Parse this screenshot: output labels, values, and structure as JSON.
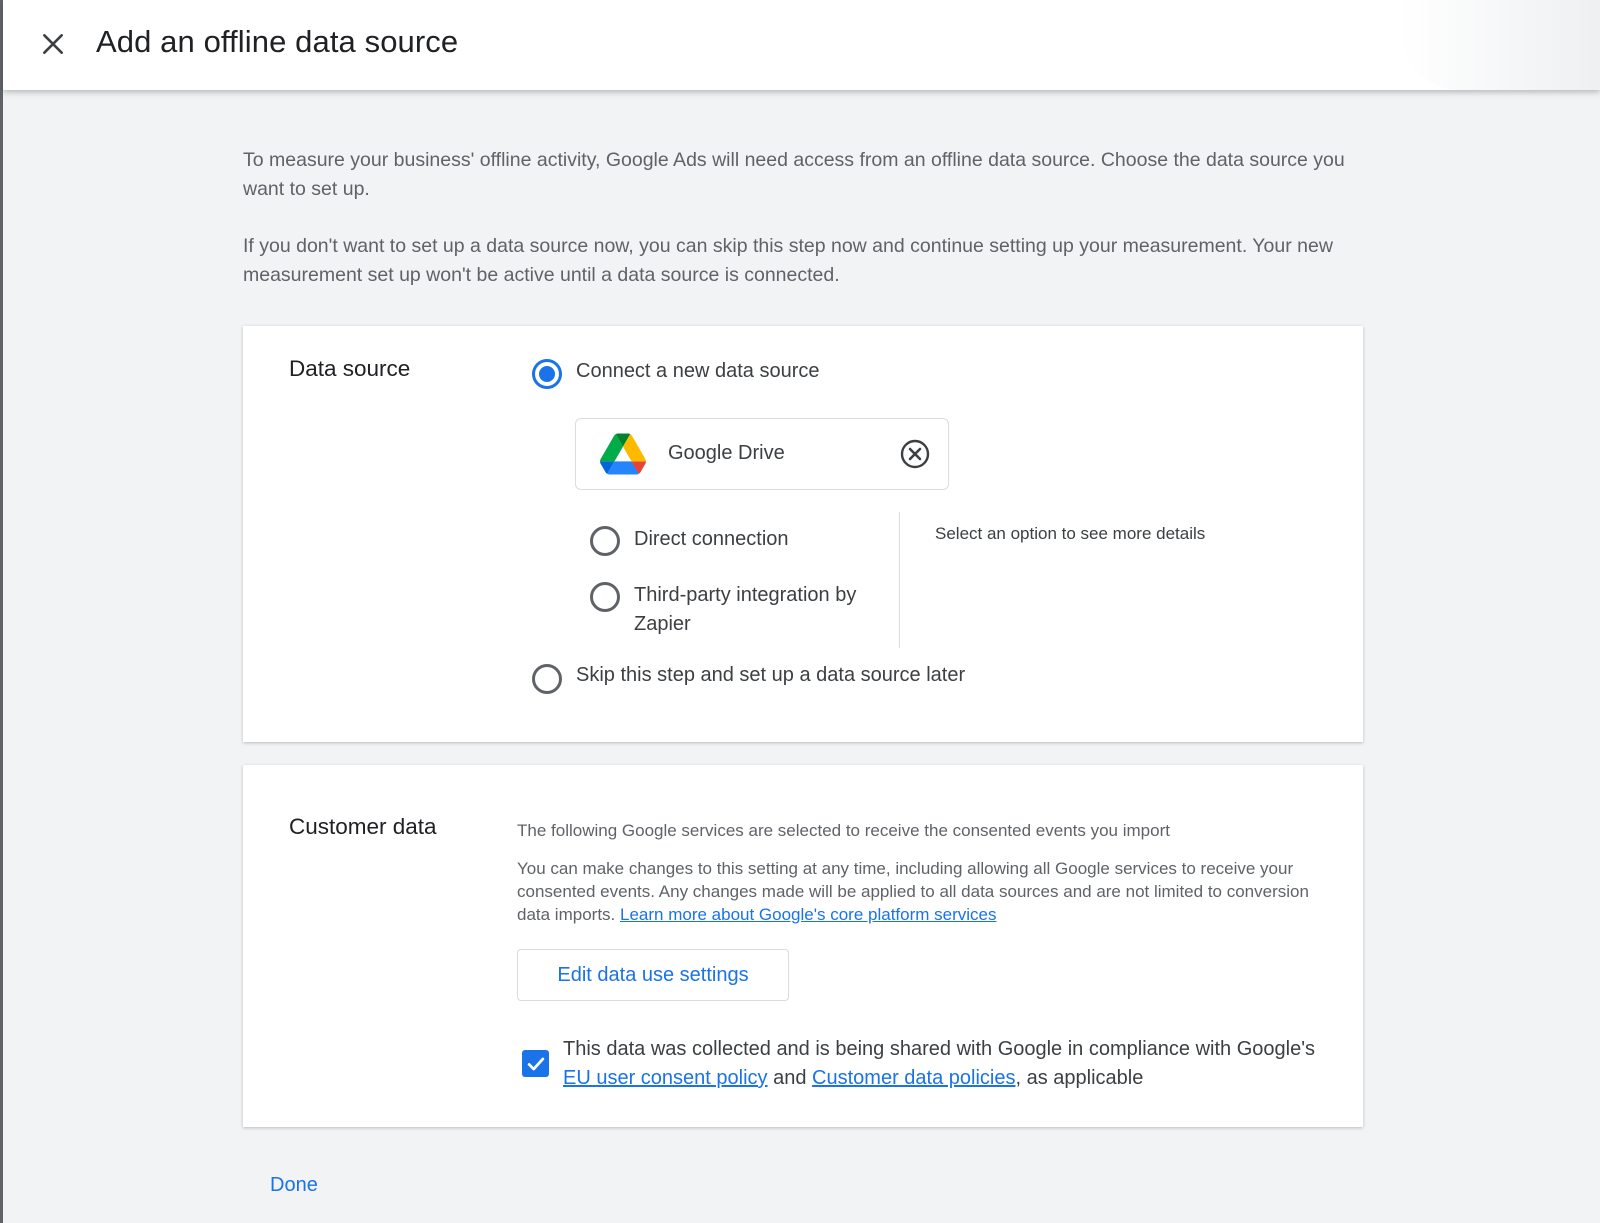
{
  "header": {
    "title": "Add an offline data source"
  },
  "intro": {
    "paragraph_1": "To measure your business' offline activity, Google Ads will need access from an offline data source. Choose the data source you want to set up.",
    "paragraph_2": "If you don't want to set up a data source now, you can skip this step now and continue setting up your measurement. Your new measurement set up won't be active until a data source is connected."
  },
  "data_source": {
    "title": "Data source",
    "options": {
      "connect_new": {
        "label": "Connect a new data source",
        "selected": true
      },
      "skip": {
        "label": "Skip this step and set up a data source later",
        "selected": false
      }
    },
    "chip": {
      "label": "Google Drive",
      "icon": "google-drive-icon"
    },
    "connection_types": [
      {
        "label": "Direct connection",
        "selected": false
      },
      {
        "label": "Third-party integration by Zapier",
        "selected": false
      }
    ],
    "details_hint": "Select an option to see more details"
  },
  "customer_data": {
    "title": "Customer data",
    "line_1": "The following Google services are selected to receive the consented events you import",
    "line_2": "You can make changes to this setting at any time, including allowing all Google services to receive your consented events. Any changes made will be applied to all data sources and are not limited to conversion data imports.",
    "learn_more_link": "Learn more about Google's core platform services",
    "edit_button": "Edit data use settings",
    "consent": {
      "checked": true,
      "text_1": "This data was collected and is being shared with Google in compliance with Google's",
      "link_1": "EU user consent policy",
      "text_2": "and",
      "link_2": "Customer data policies",
      "text_3": ", as applicable"
    }
  },
  "footer": {
    "done_label": "Done"
  },
  "colors": {
    "accent": "#1a73e8",
    "background": "#f1f3f4",
    "text_primary": "#202124",
    "text_secondary": "#5f6368"
  }
}
